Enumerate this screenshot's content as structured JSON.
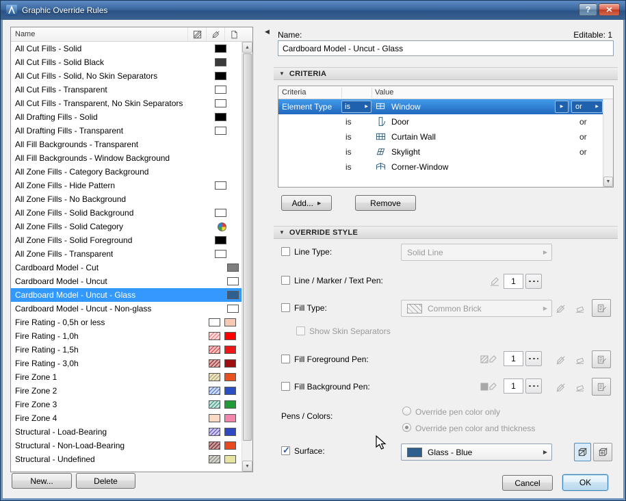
{
  "window": {
    "title": "Graphic Override Rules",
    "help_glyph": "?"
  },
  "list_panel": {
    "name_header": "Name",
    "new_button": "New...",
    "delete_button": "Delete",
    "selected_index": 18,
    "items": [
      {
        "label": "All Cut Fills - Solid",
        "align": "mid",
        "swatches": [
          {
            "color": "#000000"
          }
        ]
      },
      {
        "label": "All Cut Fills - Solid Black",
        "align": "mid",
        "swatches": [
          {
            "color": "#3A3A3A"
          }
        ]
      },
      {
        "label": "All Cut Fills - Solid, No Skin Separators",
        "align": "mid",
        "swatches": [
          {
            "color": "#000000"
          }
        ]
      },
      {
        "label": "All Cut Fills - Transparent",
        "align": "mid",
        "swatches": [
          {
            "color": "#FFFFFF"
          }
        ]
      },
      {
        "label": "All Cut Fills - Transparent, No Skin Separators",
        "align": "mid",
        "swatches": [
          {
            "color": "#FFFFFF"
          }
        ]
      },
      {
        "label": "All Drafting Fills - Solid",
        "align": "mid",
        "swatches": [
          {
            "color": "#000000"
          }
        ]
      },
      {
        "label": "All Drafting Fills - Transparent",
        "align": "mid",
        "swatches": [
          {
            "color": "#FFFFFF"
          }
        ]
      },
      {
        "label": "All Fill Backgrounds - Transparent",
        "align": "mid",
        "swatches": []
      },
      {
        "label": "All Fill Backgrounds - Window Background",
        "align": "mid",
        "swatches": []
      },
      {
        "label": "All Zone Fills - Category Background",
        "align": "mid",
        "swatches": []
      },
      {
        "label": "All Zone Fills - Hide Pattern",
        "align": "mid",
        "swatches": [
          {
            "color": "#FFFFFF"
          }
        ]
      },
      {
        "label": "All Zone Fills - No Background",
        "align": "mid",
        "swatches": []
      },
      {
        "label": "All Zone Fills - Solid Background",
        "align": "mid",
        "swatches": [
          {
            "color": "#FFFFFF"
          }
        ]
      },
      {
        "label": "All Zone Fills - Solid Category",
        "align": "mid",
        "swatches": [
          {
            "circle": true
          }
        ]
      },
      {
        "label": "All Zone Fills - Solid Foreground",
        "align": "mid",
        "swatches": [
          {
            "color": "#000000"
          }
        ]
      },
      {
        "label": "All Zone Fills - Transparent",
        "align": "mid",
        "swatches": [
          {
            "color": "#FFFFFF"
          }
        ]
      },
      {
        "label": "Cardboard Model - Cut",
        "align": "right",
        "swatches": [
          {
            "color": "#7F7F7F"
          }
        ]
      },
      {
        "label": "Cardboard Model - Uncut",
        "align": "right",
        "swatches": [
          {
            "color": "#FFFFFF"
          }
        ]
      },
      {
        "label": "Cardboard Model - Uncut - Glass",
        "align": "right",
        "swatches": [
          {
            "color": "#2E608F"
          }
        ]
      },
      {
        "label": "Cardboard Model - Uncut - Non-glass",
        "align": "right",
        "swatches": [
          {
            "color": "#FFFFFF"
          }
        ]
      },
      {
        "label": "Fire Rating - 0,5h or less",
        "align": "pair",
        "swatches": [
          {
            "color": "#FFFFFF"
          },
          {
            "color": "#F6C9B4"
          }
        ]
      },
      {
        "label": "Fire Rating - 1,0h",
        "align": "pair",
        "swatches": [
          {
            "color": "#F8D6D6",
            "hatch": "#E87878"
          },
          {
            "color": "#FF0000"
          }
        ]
      },
      {
        "label": "Fire Rating - 1,5h",
        "align": "pair",
        "swatches": [
          {
            "color": "#F2BCBC",
            "hatch": "#D04848"
          },
          {
            "color": "#EE1616"
          }
        ]
      },
      {
        "label": "Fire Rating - 3,0h",
        "align": "pair",
        "swatches": [
          {
            "color": "#DCA8A8",
            "hatch": "#8B2424"
          },
          {
            "color": "#9E1010"
          }
        ]
      },
      {
        "label": "Fire Zone 1",
        "align": "pair",
        "swatches": [
          {
            "color": "#E9E2C8",
            "hatch": "#AFA25E"
          },
          {
            "color": "#E8511E"
          }
        ]
      },
      {
        "label": "Fire Zone 2",
        "align": "pair",
        "swatches": [
          {
            "color": "#CBD9F2",
            "hatch": "#5574C8"
          },
          {
            "color": "#2D4FC4"
          }
        ]
      },
      {
        "label": "Fire Zone 3",
        "align": "pair",
        "swatches": [
          {
            "color": "#C4E2DA",
            "hatch": "#35917F"
          },
          {
            "color": "#1F9A37"
          }
        ]
      },
      {
        "label": "Fire Zone 4",
        "align": "pair",
        "swatches": [
          {
            "color": "#F8DAC5"
          },
          {
            "color": "#F286AC"
          }
        ]
      },
      {
        "label": "Structural - Load-Bearing",
        "align": "pair",
        "swatches": [
          {
            "color": "#CBC5EA",
            "hatch": "#584FB4"
          },
          {
            "color": "#2F49C2"
          }
        ]
      },
      {
        "label": "Structural - Non-Load-Bearing",
        "align": "pair",
        "swatches": [
          {
            "color": "#C49A9A",
            "hatch": "#742424"
          },
          {
            "color": "#E8491E"
          }
        ]
      },
      {
        "label": "Structural - Undefined",
        "align": "pair",
        "swatches": [
          {
            "color": "#D2D2CA",
            "hatch": "#84847C"
          },
          {
            "color": "#E7E3A2"
          }
        ]
      }
    ]
  },
  "detail_panel": {
    "name_label": "Name:",
    "editable_label": "Editable: 1",
    "name_value": "Cardboard Model - Uncut - Glass",
    "criteria": {
      "section_title": "CRITERIA",
      "columns": {
        "criteria": "Criteria",
        "value": "Value"
      },
      "rows": [
        {
          "criteria": "Element Type",
          "operator": "is",
          "icon": "window-icon",
          "value": "Window",
          "conjunction": "or",
          "selected": true
        },
        {
          "criteria": "",
          "operator": "is",
          "icon": "door-icon",
          "value": "Door",
          "conjunction": "or",
          "selected": false
        },
        {
          "criteria": "",
          "operator": "is",
          "icon": "curtain-wall-icon",
          "value": "Curtain Wall",
          "conjunction": "or",
          "selected": false
        },
        {
          "criteria": "",
          "operator": "is",
          "icon": "skylight-icon",
          "value": "Skylight",
          "conjunction": "or",
          "selected": false
        },
        {
          "criteria": "",
          "operator": "is",
          "icon": "corner-window-icon",
          "value": "Corner-Window",
          "conjunction": "",
          "selected": false
        }
      ],
      "add_button": "Add...",
      "remove_button": "Remove"
    },
    "override_style": {
      "section_title": "OVERRIDE STYLE",
      "line_type": {
        "label": "Line Type:",
        "checked": false,
        "value": "Solid Line"
      },
      "line_pen": {
        "label": "Line / Marker / Text Pen:",
        "checked": false,
        "value": "1"
      },
      "fill_type": {
        "label": "Fill Type:",
        "checked": false,
        "value": "Common Brick"
      },
      "show_skin_separators": {
        "label": "Show Skin Separators",
        "checked": false
      },
      "fill_fg_pen": {
        "label": "Fill Foreground Pen:",
        "checked": false,
        "value": "1"
      },
      "fill_bg_pen": {
        "label": "Fill Background Pen:",
        "checked": false,
        "value": "1"
      },
      "pens_colors": {
        "label": "Pens / Colors:",
        "options": [
          {
            "label": "Override pen color only",
            "selected": false
          },
          {
            "label": "Override pen color and thickness",
            "selected": true
          }
        ]
      },
      "surface": {
        "label": "Surface:",
        "checked": true,
        "value": "Glass - Blue",
        "swatch_color": "#2E608F"
      }
    },
    "cancel_button": "Cancel",
    "ok_button": "OK"
  },
  "icons": [
    "archicad-logo-icon",
    "help-icon",
    "close-icon",
    "fill-column-icon",
    "pen-column-icon",
    "surface-column-icon",
    "window-icon",
    "door-icon",
    "curtain-wall-icon",
    "skylight-icon",
    "corner-window-icon",
    "dropdown-arrow-icon",
    "scroll-up-icon",
    "scroll-down-icon",
    "collapse-panel-icon",
    "marker-pen-icon",
    "dashed-line-icon",
    "hatch-pen-icon",
    "solid-pen-icon",
    "pen-slash-icon",
    "eraser-icon",
    "page-pen-icon",
    "surface-paint-icon",
    "surface-texture-icon",
    "category-colors-icon",
    "mouse-cursor"
  ]
}
